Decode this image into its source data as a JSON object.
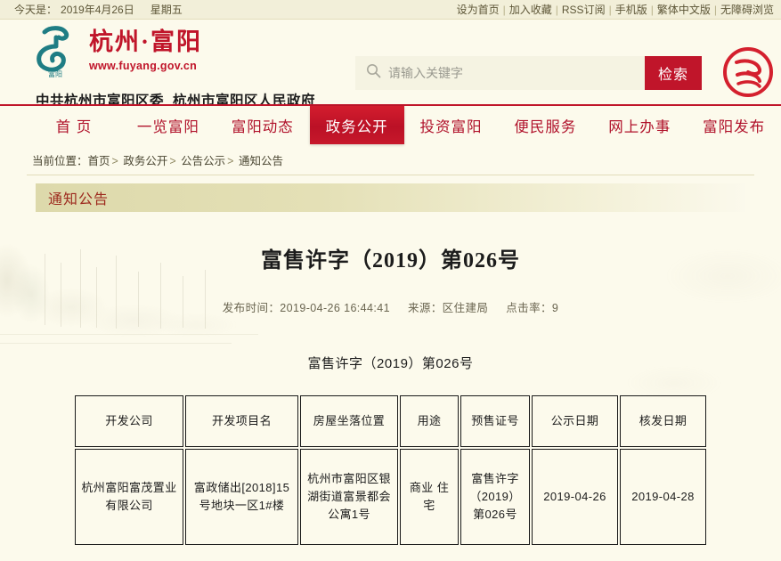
{
  "topbar": {
    "date_prefix": "今天是：",
    "date": "2019年4月26日",
    "weekday": "星期五",
    "links": [
      "设为首页",
      "加入收藏",
      "RSS订阅",
      "手机版",
      "繁体中文版",
      "无障碍浏览"
    ],
    "separator": "|"
  },
  "header": {
    "logo_cn": "杭州·富阳",
    "logo_url": "www.fuyang.gov.cn",
    "gov_line_1": "中共杭州市富阳区委",
    "gov_line_2": "杭州市富阳区人民政府",
    "search": {
      "placeholder": "请输入关键字",
      "value": "",
      "button_label": "检索",
      "icon": "search-icon"
    },
    "seal_icon": "fuyang-seal-icon"
  },
  "nav": {
    "items": [
      {
        "label": "首 页",
        "active": false
      },
      {
        "label": "一览富阳",
        "active": false
      },
      {
        "label": "富阳动态",
        "active": false
      },
      {
        "label": "政务公开",
        "active": true
      },
      {
        "label": "投资富阳",
        "active": false
      },
      {
        "label": "便民服务",
        "active": false
      },
      {
        "label": "网上办事",
        "active": false
      },
      {
        "label": "富阳发布",
        "active": false
      }
    ]
  },
  "breadcrumb": {
    "label": "当前位置：",
    "arrow": ">",
    "items": [
      "首页",
      "政务公开",
      "公告公示",
      "通知公告"
    ]
  },
  "channel": {
    "title": "通知公告"
  },
  "article": {
    "title": "富售许字（2019）第026号",
    "publish_label": "发布时间：",
    "publish_time": "2019-04-26 16:44:41",
    "source_label": "来源：",
    "source": "区住建局",
    "hits_label": "点击率：",
    "hits": "9",
    "subtitle": "富售许字（2019）第026号"
  },
  "table": {
    "headers": [
      "开发公司",
      "开发项目名",
      "房屋坐落位置",
      "用途",
      "预售证号",
      "公示日期",
      "核发日期"
    ],
    "rows": [
      [
        "杭州富阳富茂置业有限公司",
        "富政储出[2018]15号地块一区1#楼",
        "杭州市富阳区银湖街道富景都会公寓1号",
        "商业 住宅",
        "富售许字（2019）第026号",
        "2019-04-26",
        "2019-04-28"
      ]
    ]
  },
  "colors": {
    "brand_red": "#c0152a",
    "page_bg": "#fcfaec",
    "topbar_bg": "#f2efd9",
    "channel_bg": "#ddd9ab",
    "logo_teal": "#1f7d84"
  }
}
